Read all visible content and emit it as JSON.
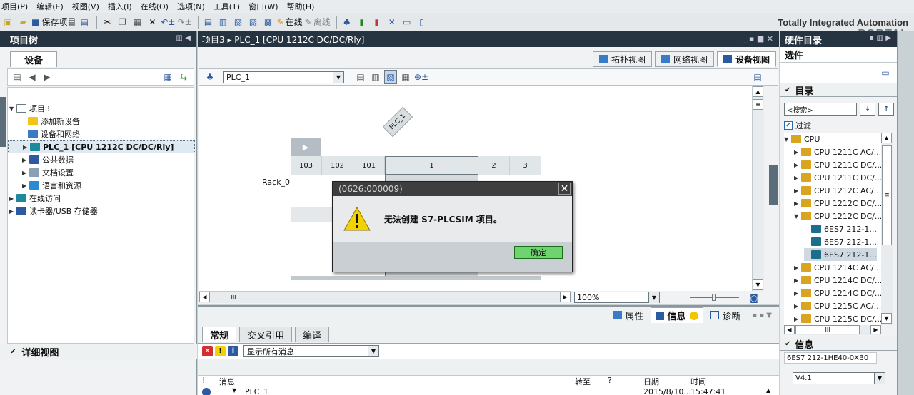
{
  "menu": [
    "项目(P)",
    "编辑(E)",
    "视图(V)",
    "插入(I)",
    "在线(O)",
    "选项(N)",
    "工具(T)",
    "窗口(W)",
    "帮助(H)"
  ],
  "toolbar": {
    "save_label": "保存项目",
    "online_label": "在线",
    "offline_label": "离线"
  },
  "brand": {
    "line1": "Totally Integrated Automation",
    "line2": "PORTAL"
  },
  "left": {
    "title": "项目树",
    "tab": "设备",
    "tree": [
      {
        "label": "项目3",
        "level": 0,
        "expanded": true,
        "icon": "project-icon"
      },
      {
        "label": "添加新设备",
        "level": 1,
        "icon": "add-device-icon"
      },
      {
        "label": "设备和网络",
        "level": 1,
        "icon": "network-icon"
      },
      {
        "label": "PLC_1 [CPU 1212C DC/DC/Rly]",
        "level": 1,
        "icon": "plc-icon",
        "selected": true
      },
      {
        "label": "公共数据",
        "level": 1,
        "icon": "common-data-icon"
      },
      {
        "label": "文档设置",
        "level": 1,
        "icon": "doc-settings-icon"
      },
      {
        "label": "语言和资源",
        "level": 1,
        "icon": "language-icon"
      },
      {
        "label": "在线访问",
        "level": 0,
        "icon": "online-access-icon"
      },
      {
        "label": "读卡器/USB 存储器",
        "level": 0,
        "icon": "card-reader-icon"
      }
    ],
    "detail_title": "详细视图"
  },
  "center": {
    "breadcrumb": "项目3  ▸  PLC_1 [CPU 1212C DC/DC/Rly]",
    "view_tabs": [
      "拓扑视图",
      "网络视图",
      "设备视图"
    ],
    "device_select": "PLC_1",
    "rack_label": "Rack_0",
    "plc_tag": "PLC_1",
    "slots": [
      "103",
      "102",
      "101",
      "1",
      "2",
      "3"
    ],
    "zoom": "100%",
    "scroll_mark": "III"
  },
  "dialog": {
    "title": "(0626:000009)",
    "message": "无法创建 S7-PLCSIM 项目。",
    "ok_label": "确定"
  },
  "bottom": {
    "inspector_tabs": [
      "属性",
      "信息",
      "诊断"
    ],
    "sub_tabs": [
      "常规",
      "交叉引用",
      "编译"
    ],
    "filter": "显示所有消息",
    "columns": {
      "bang": "!",
      "message": "消息",
      "goto": "转至",
      "q": "?",
      "date": "日期",
      "time": "时间"
    },
    "row": {
      "message": "PLC_1",
      "date": "2015/8/10...",
      "time": "15:47:41"
    }
  },
  "right": {
    "title": "硬件目录",
    "options": "选件",
    "catalog_title": "目录",
    "search_placeholder": "<搜索>",
    "filter_label": "过滤",
    "catalog": [
      {
        "label": "CPU",
        "level": 0
      },
      {
        "label": "CPU 1211C AC/...",
        "level": 1
      },
      {
        "label": "CPU 1211C DC/...",
        "level": 1
      },
      {
        "label": "CPU 1211C DC/...",
        "level": 1
      },
      {
        "label": "CPU 1212C AC/...",
        "level": 1
      },
      {
        "label": "CPU 1212C DC/...",
        "level": 1
      },
      {
        "label": "CPU 1212C DC/...",
        "level": 1,
        "expanded": true
      },
      {
        "label": "6ES7 212-1...",
        "level": 2
      },
      {
        "label": "6ES7 212-1...",
        "level": 2
      },
      {
        "label": "6ES7 212-1...",
        "level": 2,
        "selected": true
      },
      {
        "label": "CPU 1214C AC/...",
        "level": 1
      },
      {
        "label": "CPU 1214C DC/...",
        "level": 1
      },
      {
        "label": "CPU 1214C DC/...",
        "level": 1
      },
      {
        "label": "CPU 1215C AC/...",
        "level": 1
      },
      {
        "label": "CPU 1215C DC/...",
        "level": 1
      }
    ],
    "catalog_scroll_mark": "III",
    "info_title": "信息",
    "info_value": "6ES7 212-1HE40-0XB0",
    "version": "V4.1"
  },
  "colors": {
    "header": "#263340",
    "ok": "#6fd36f",
    "warning": "#f2d200"
  }
}
